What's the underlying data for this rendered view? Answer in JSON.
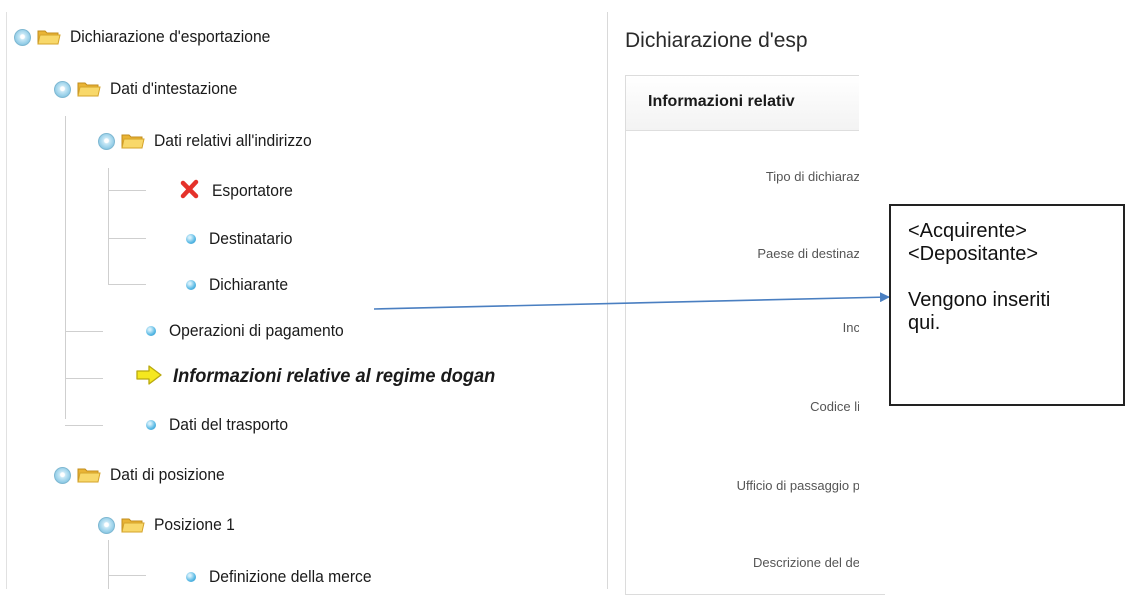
{
  "tree": {
    "nodes": [
      {
        "id": "root",
        "label": "Dichiarazione d'esportazione",
        "icon": "folder-open"
      },
      {
        "id": "dati-intestazione",
        "label": "Dati d'intestazione",
        "icon": "folder-open"
      },
      {
        "id": "dati-indirizzo",
        "label": "Dati relativi all'indirizzo",
        "icon": "folder-open"
      },
      {
        "id": "esportatore",
        "label": "Esportatore",
        "icon": "error-x"
      },
      {
        "id": "destinatario",
        "label": "Destinatario",
        "icon": "bullet"
      },
      {
        "id": "dichiarante",
        "label": "Dichiarante",
        "icon": "bullet"
      },
      {
        "id": "operazioni-pagamento",
        "label": "Operazioni di pagamento",
        "icon": "bullet"
      },
      {
        "id": "info-regime",
        "label": "Informazioni relative al regime dogan",
        "icon": "current-arrow"
      },
      {
        "id": "dati-trasporto",
        "label": "Dati del trasporto",
        "icon": "bullet"
      },
      {
        "id": "dati-posizione",
        "label": "Dati di posizione",
        "icon": "folder-open"
      },
      {
        "id": "posizione-1",
        "label": "Posizione 1",
        "icon": "folder-open"
      },
      {
        "id": "definizione-merce",
        "label": "Definizione della merce",
        "icon": "bullet"
      }
    ]
  },
  "form": {
    "title": "Dichiarazione d'esp",
    "section_header": "Informazioni relativ",
    "fields": [
      "Tipo di dichiaraz",
      "Paese di destinaz",
      "Inc",
      "Codice li",
      "Ufficio di passaggio p",
      "Descrizione del de"
    ]
  },
  "callout": {
    "line1": "<Acquirente>",
    "line2": "<Depositante>",
    "line3": "Vengono inseriti",
    "line4": "qui."
  },
  "colors": {
    "error": "#e5322b",
    "current": "#f5e81f",
    "bullet": "#3ea6d8",
    "folder": "#f3c94d",
    "arrow": "#4a7fc1"
  }
}
